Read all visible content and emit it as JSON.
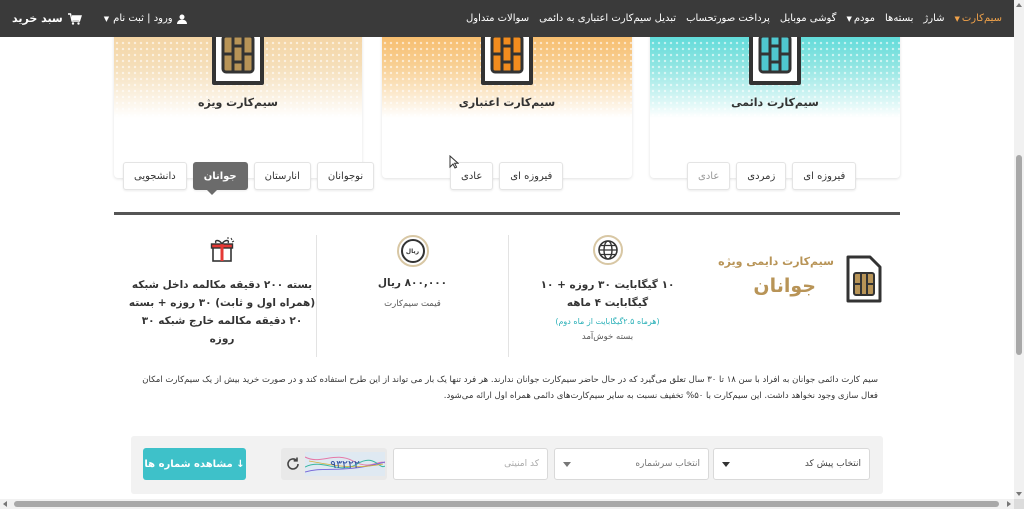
{
  "nav": {
    "items": [
      {
        "label": "سیم‌کارت",
        "has_caret": true,
        "active": true
      },
      {
        "label": "شارژ",
        "has_caret": false,
        "active": false
      },
      {
        "label": "بسته‌ها",
        "has_caret": false,
        "active": false
      },
      {
        "label": "مودم",
        "has_caret": true,
        "active": false
      },
      {
        "label": "گوشی موبایل",
        "has_caret": false,
        "active": false
      },
      {
        "label": "پرداخت صورتحساب",
        "has_caret": false,
        "active": false
      },
      {
        "label": "تبدیل سیم‌کارت اعتباری به دائمی",
        "has_caret": false,
        "active": false
      },
      {
        "label": "سوالات متداول",
        "has_caret": false,
        "active": false
      }
    ],
    "login_label": "ورود | ثبت نام",
    "cart_label": "سبد خرید",
    "accent_color": "#f0a24a"
  },
  "cards": {
    "vizheh": {
      "title": "سیم‌کارت ویژه",
      "color": "#b89457"
    },
    "etebari": {
      "title": "سیم‌کارت اعتباری",
      "color": "#f28c1e"
    },
    "daemi": {
      "title": "سیم‌کارت دائمی",
      "color": "#27cfcf"
    }
  },
  "tabs": {
    "vizheh": [
      "نوجوانان",
      "انارستان",
      "جوانان",
      "دانشجویی"
    ],
    "vizheh_active": "جوانان",
    "etebari": [
      "فیروزه ای",
      "عادی"
    ],
    "daemi": [
      "فیروزه ای",
      "زمردی",
      "عادی"
    ]
  },
  "details": {
    "brand_line1": "سیم‌کارت دایمی ویژه",
    "brand_line2": "جوانان",
    "internet_main": "۱۰ گیگابایت ۳۰ روزه + ۱۰ گیگابایت ۴ ماهه",
    "internet_note": "(هرماه ۲.۵گیگابایت از ماه دوم)",
    "internet_sub": "بسته خوش‌آمد",
    "price_badge": "ریال",
    "price_main": "۸۰۰,۰۰۰ ریال",
    "price_sub": "قیمت سیم‌کارت",
    "gift_main": "بسته ۲۰۰ دقیقه مکالمه داخل شبکه (همراه اول و ثابت) ۳۰ روزه + بسته ۲۰ دقیقه مکالمه خارج شبکه ۳۰ روزه"
  },
  "description": "سیم کارت دائمی جوانان به افراد با سن ۱۸ تا ۳۰ سال تعلق می‌گیرد که در حال حاضر سیم‌کارت جوانان ندارند. هر فرد تنها یک بار می تواند از این طرح استفاده کند و در صورت خرید بیش از یک سیم‌کارت امکان فعال سازی وجود نخواهد داشت. این سیم‌کارت با ۵۰% تخفیف نسبت به سایر سیم‌کارت‌های دائمی همراه اول ارائه می‌شود.",
  "search": {
    "prefix_label": "انتخاب پیش کد",
    "series_label": "انتخاب سرشماره",
    "code_placeholder": "کد امنیتی",
    "captcha_text": "۹۳۲۲۲",
    "view_button": "↓ مشاهده شماره ها",
    "button_color": "#3ec1c9"
  }
}
